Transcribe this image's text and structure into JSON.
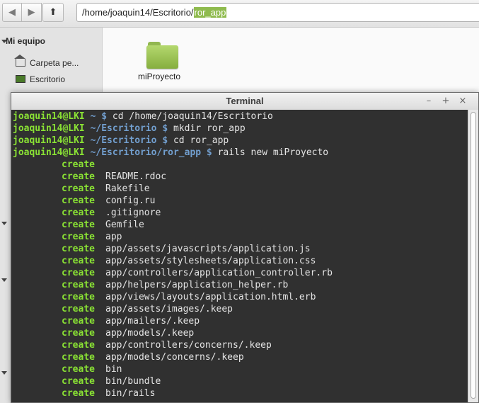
{
  "toolbar": {
    "back_icon": "arrow-left-icon",
    "forward_icon": "arrow-right-icon",
    "up_icon": "arrow-up-icon",
    "path_prefix": "/home/joaquin14/Escritorio/",
    "path_selected": "ror_app"
  },
  "sidebar": {
    "header": "Mi equipo",
    "items": [
      {
        "label": "Carpeta pe...",
        "icon": "home-icon"
      },
      {
        "label": "Escritorio",
        "icon": "desktop-icon"
      }
    ]
  },
  "content": {
    "items": [
      {
        "label": "miProyecto",
        "icon": "folder-icon"
      }
    ]
  },
  "terminal": {
    "title": "Terminal",
    "controls": {
      "minimize": "–",
      "maximize": "+",
      "close": "×"
    },
    "prompt_user": "joaquin14@LKI",
    "commands": [
      {
        "path": " ~ $",
        "cmd": " cd /home/joaquin14/Escritorio"
      },
      {
        "path": " ~/Escritorio $",
        "cmd": " mkdir ror_app"
      },
      {
        "path": " ~/Escritorio $",
        "cmd": " cd ror_app"
      },
      {
        "path": " ~/Escritorio/ror_app $",
        "cmd": " rails new miProyecto"
      }
    ],
    "action": "create",
    "created": [
      "",
      "README.rdoc",
      "Rakefile",
      "config.ru",
      ".gitignore",
      "Gemfile",
      "app",
      "app/assets/javascripts/application.js",
      "app/assets/stylesheets/application.css",
      "app/controllers/application_controller.rb",
      "app/helpers/application_helper.rb",
      "app/views/layouts/application.html.erb",
      "app/assets/images/.keep",
      "app/mailers/.keep",
      "app/models/.keep",
      "app/controllers/concerns/.keep",
      "app/models/concerns/.keep",
      "bin",
      "bin/bundle",
      "bin/rails"
    ],
    "colors": {
      "user": "#8ae234",
      "path": "#729fcf",
      "background": "#303030"
    }
  }
}
